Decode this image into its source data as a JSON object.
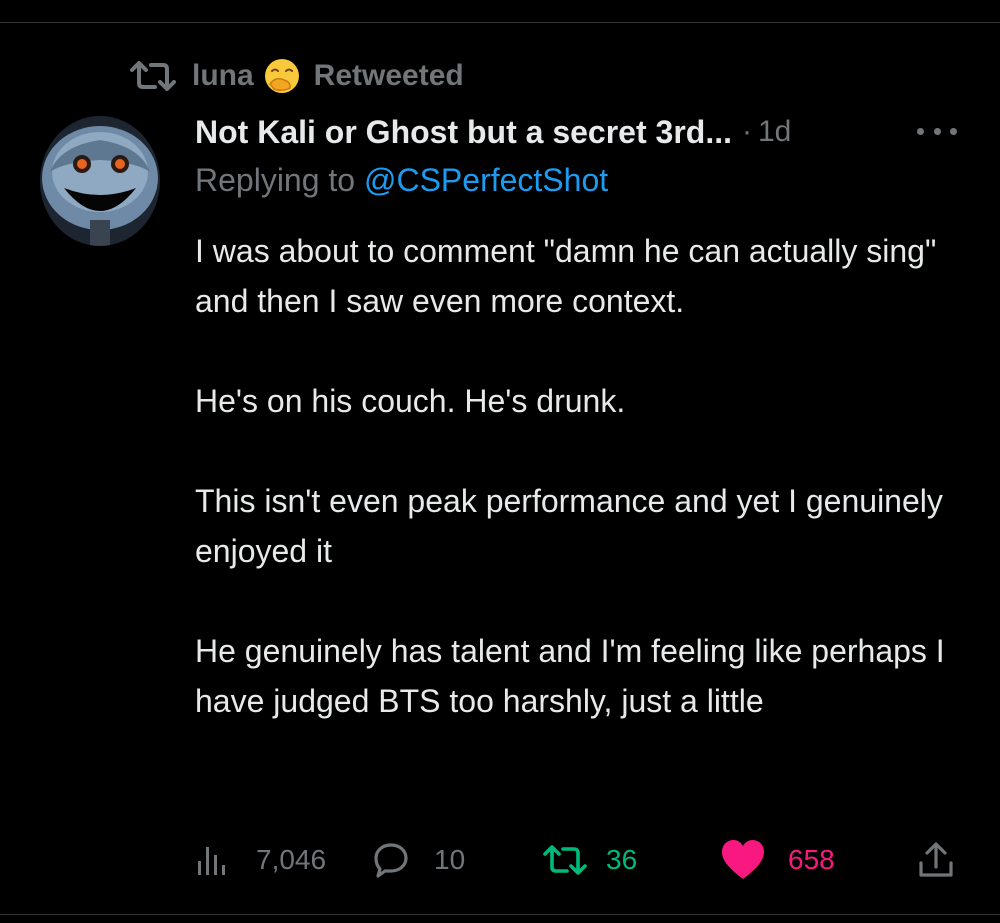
{
  "retweet_header": {
    "user": "luna",
    "label": "Retweeted",
    "emoji": "face-with-hand-over-mouth"
  },
  "tweet": {
    "display_name": "Not Kali or Ghost but a secret 3rd...",
    "separator": "·",
    "time": "1d",
    "reply_prefix": "Replying to",
    "reply_to": "@CSPerfectShot",
    "paragraphs": [
      "I was about to comment \"damn he can actually sing\" and then I saw even more context.",
      "He's on his couch. He's drunk.",
      "This isn't even peak performance and yet I genuinely enjoyed it",
      "He genuinely has talent and I'm feeling like perhaps I have judged BTS too harshly, just a little"
    ]
  },
  "actions": {
    "views": "7,046",
    "replies": "10",
    "retweets": "36",
    "likes": "658",
    "liked": true,
    "retweeted": true
  },
  "colors": {
    "background": "#000000",
    "text": "#e7e9ea",
    "muted": "#71767b",
    "link": "#1d9bf0",
    "retweet": "#00ba7c",
    "like": "#f91880"
  },
  "icons": [
    "retweet-icon",
    "emoji-icon",
    "more-icon",
    "views-icon",
    "reply-icon",
    "like-icon",
    "share-icon"
  ]
}
